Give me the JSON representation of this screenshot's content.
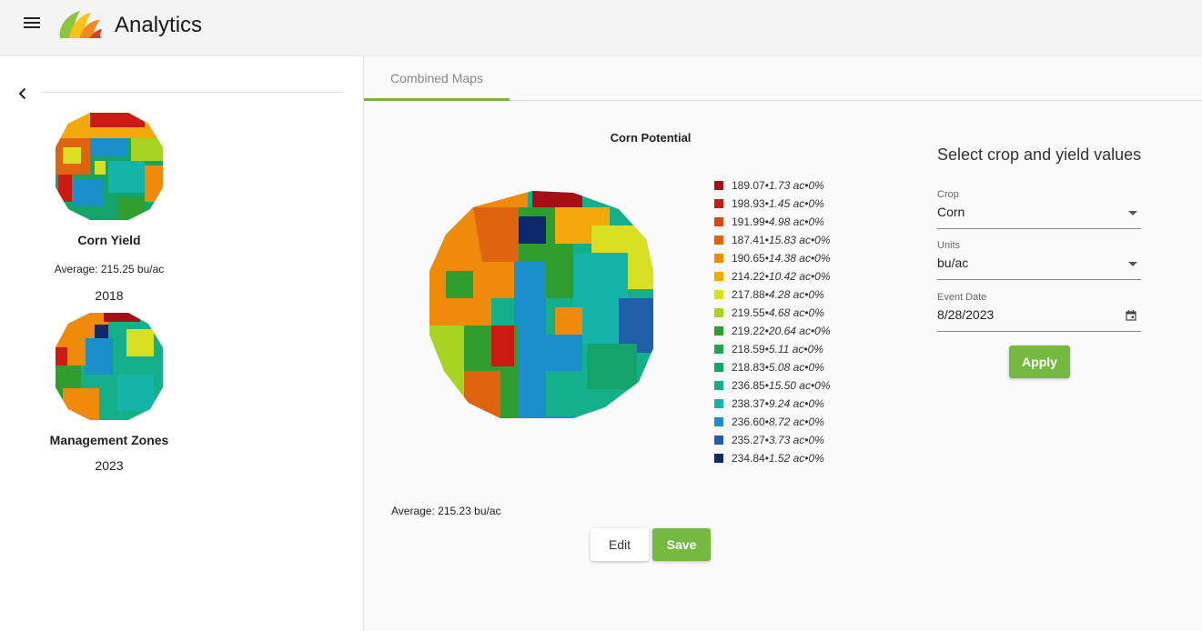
{
  "header": {
    "title": "Analytics"
  },
  "sidebar": {
    "cards": [
      {
        "title": "Corn Yield",
        "average": "Average: 215.25 bu/ac",
        "year": "2018"
      },
      {
        "title": "Management Zones",
        "year": "2023"
      }
    ]
  },
  "tabs": [
    {
      "label": "Combined Maps",
      "active": true
    }
  ],
  "main": {
    "map_title": "Corn Potential",
    "average": "Average: 215.23 bu/ac",
    "edit_label": "Edit",
    "save_label": "Save",
    "legend": [
      {
        "value": "189.07",
        "area": "1.73 ac",
        "pct": "0%",
        "color": "#a50f15"
      },
      {
        "value": "198.93",
        "area": "1.45 ac",
        "pct": "0%",
        "color": "#cc1a12"
      },
      {
        "value": "191.99",
        "area": "4.98 ac",
        "pct": "0%",
        "color": "#d94712"
      },
      {
        "value": "187.41",
        "area": "15.83 ac",
        "pct": "0%",
        "color": "#e0640f"
      },
      {
        "value": "190.65",
        "area": "14.38 ac",
        "pct": "0%",
        "color": "#f08a0a"
      },
      {
        "value": "214.22",
        "area": "10.42 ac",
        "pct": "0%",
        "color": "#f5a80a"
      },
      {
        "value": "217.88",
        "area": "4.28 ac",
        "pct": "0%",
        "color": "#d9e021"
      },
      {
        "value": "219.55",
        "area": "4.68 ac",
        "pct": "0%",
        "color": "#a6d421"
      },
      {
        "value": "219.22",
        "area": "20.64 ac",
        "pct": "0%",
        "color": "#2e9e2e"
      },
      {
        "value": "218.59",
        "area": "5.11 ac",
        "pct": "0%",
        "color": "#21a54f"
      },
      {
        "value": "218.83",
        "area": "5.08 ac",
        "pct": "0%",
        "color": "#14a36b"
      },
      {
        "value": "236.85",
        "area": "15.50 ac",
        "pct": "0%",
        "color": "#14b08a"
      },
      {
        "value": "238.37",
        "area": "9.24 ac",
        "pct": "0%",
        "color": "#14b5a8"
      },
      {
        "value": "236.60",
        "area": "8.72 ac",
        "pct": "0%",
        "color": "#1a8fcc"
      },
      {
        "value": "235.27",
        "area": "3.73 ac",
        "pct": "0%",
        "color": "#1f5fa8"
      },
      {
        "value": "234.84",
        "area": "1.52 ac",
        "pct": "0%",
        "color": "#0c2a6b"
      }
    ]
  },
  "form": {
    "title": "Select crop and yield values",
    "crop": {
      "label": "Crop",
      "value": "Corn"
    },
    "units": {
      "label": "Units",
      "value": "bu/ac"
    },
    "event_date": {
      "label": "Event Date",
      "value": "8/28/2023"
    },
    "apply_label": "Apply"
  }
}
